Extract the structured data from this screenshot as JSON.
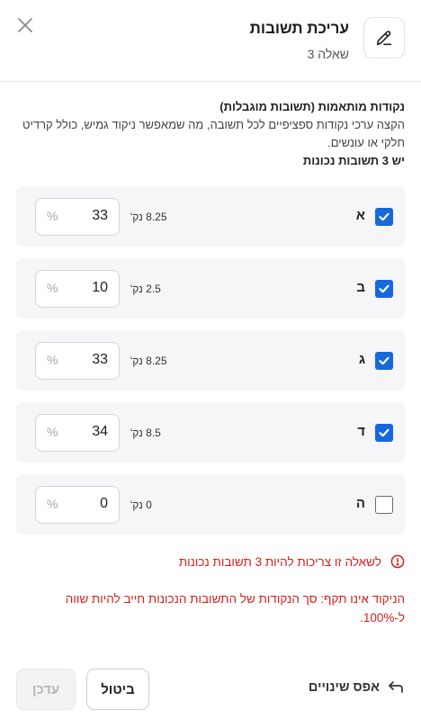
{
  "header": {
    "title": "עריכת תשובות",
    "subtitle": "שאלה 3",
    "edit_icon": "pencil-icon",
    "close_icon": "close-icon"
  },
  "section": {
    "title": "נקודות מותאמות (תשובות מוגבלות)",
    "description": "הקצה ערכי נקודות ספציפיים לכל תשובה, מה שמאפשר ניקוד גמיש, כולל קרדיט חלקי או עונשים.",
    "count_text": "יש 3 תשובות נכונות"
  },
  "answers": [
    {
      "letter": "א",
      "checked": true,
      "points": "8.25 נק'",
      "percent": "33",
      "percent_sign": "%"
    },
    {
      "letter": "ב",
      "checked": true,
      "points": "2.5 נק'",
      "percent": "10",
      "percent_sign": "%"
    },
    {
      "letter": "ג",
      "checked": true,
      "points": "8.25 נק'",
      "percent": "33",
      "percent_sign": "%"
    },
    {
      "letter": "ד",
      "checked": true,
      "points": "8.5 נק'",
      "percent": "34",
      "percent_sign": "%"
    },
    {
      "letter": "ה",
      "checked": false,
      "points": "0 נק'",
      "percent": "0",
      "percent_sign": "%"
    }
  ],
  "errors": {
    "correct_count": "לשאלה זו צריכות להיות 3 תשובות נכונות",
    "invalid_scoring": "הניקוד אינו תקף: סך הנקודות של התשובות הנכונות חייב להיות שווה ל-100%."
  },
  "footer": {
    "reset_label": "אפס שינויים",
    "cancel_label": "ביטול",
    "update_label": "עדכן"
  },
  "colors": {
    "accent": "#1668dc",
    "error": "#d4201b",
    "row_bg": "#f6f6f8"
  }
}
